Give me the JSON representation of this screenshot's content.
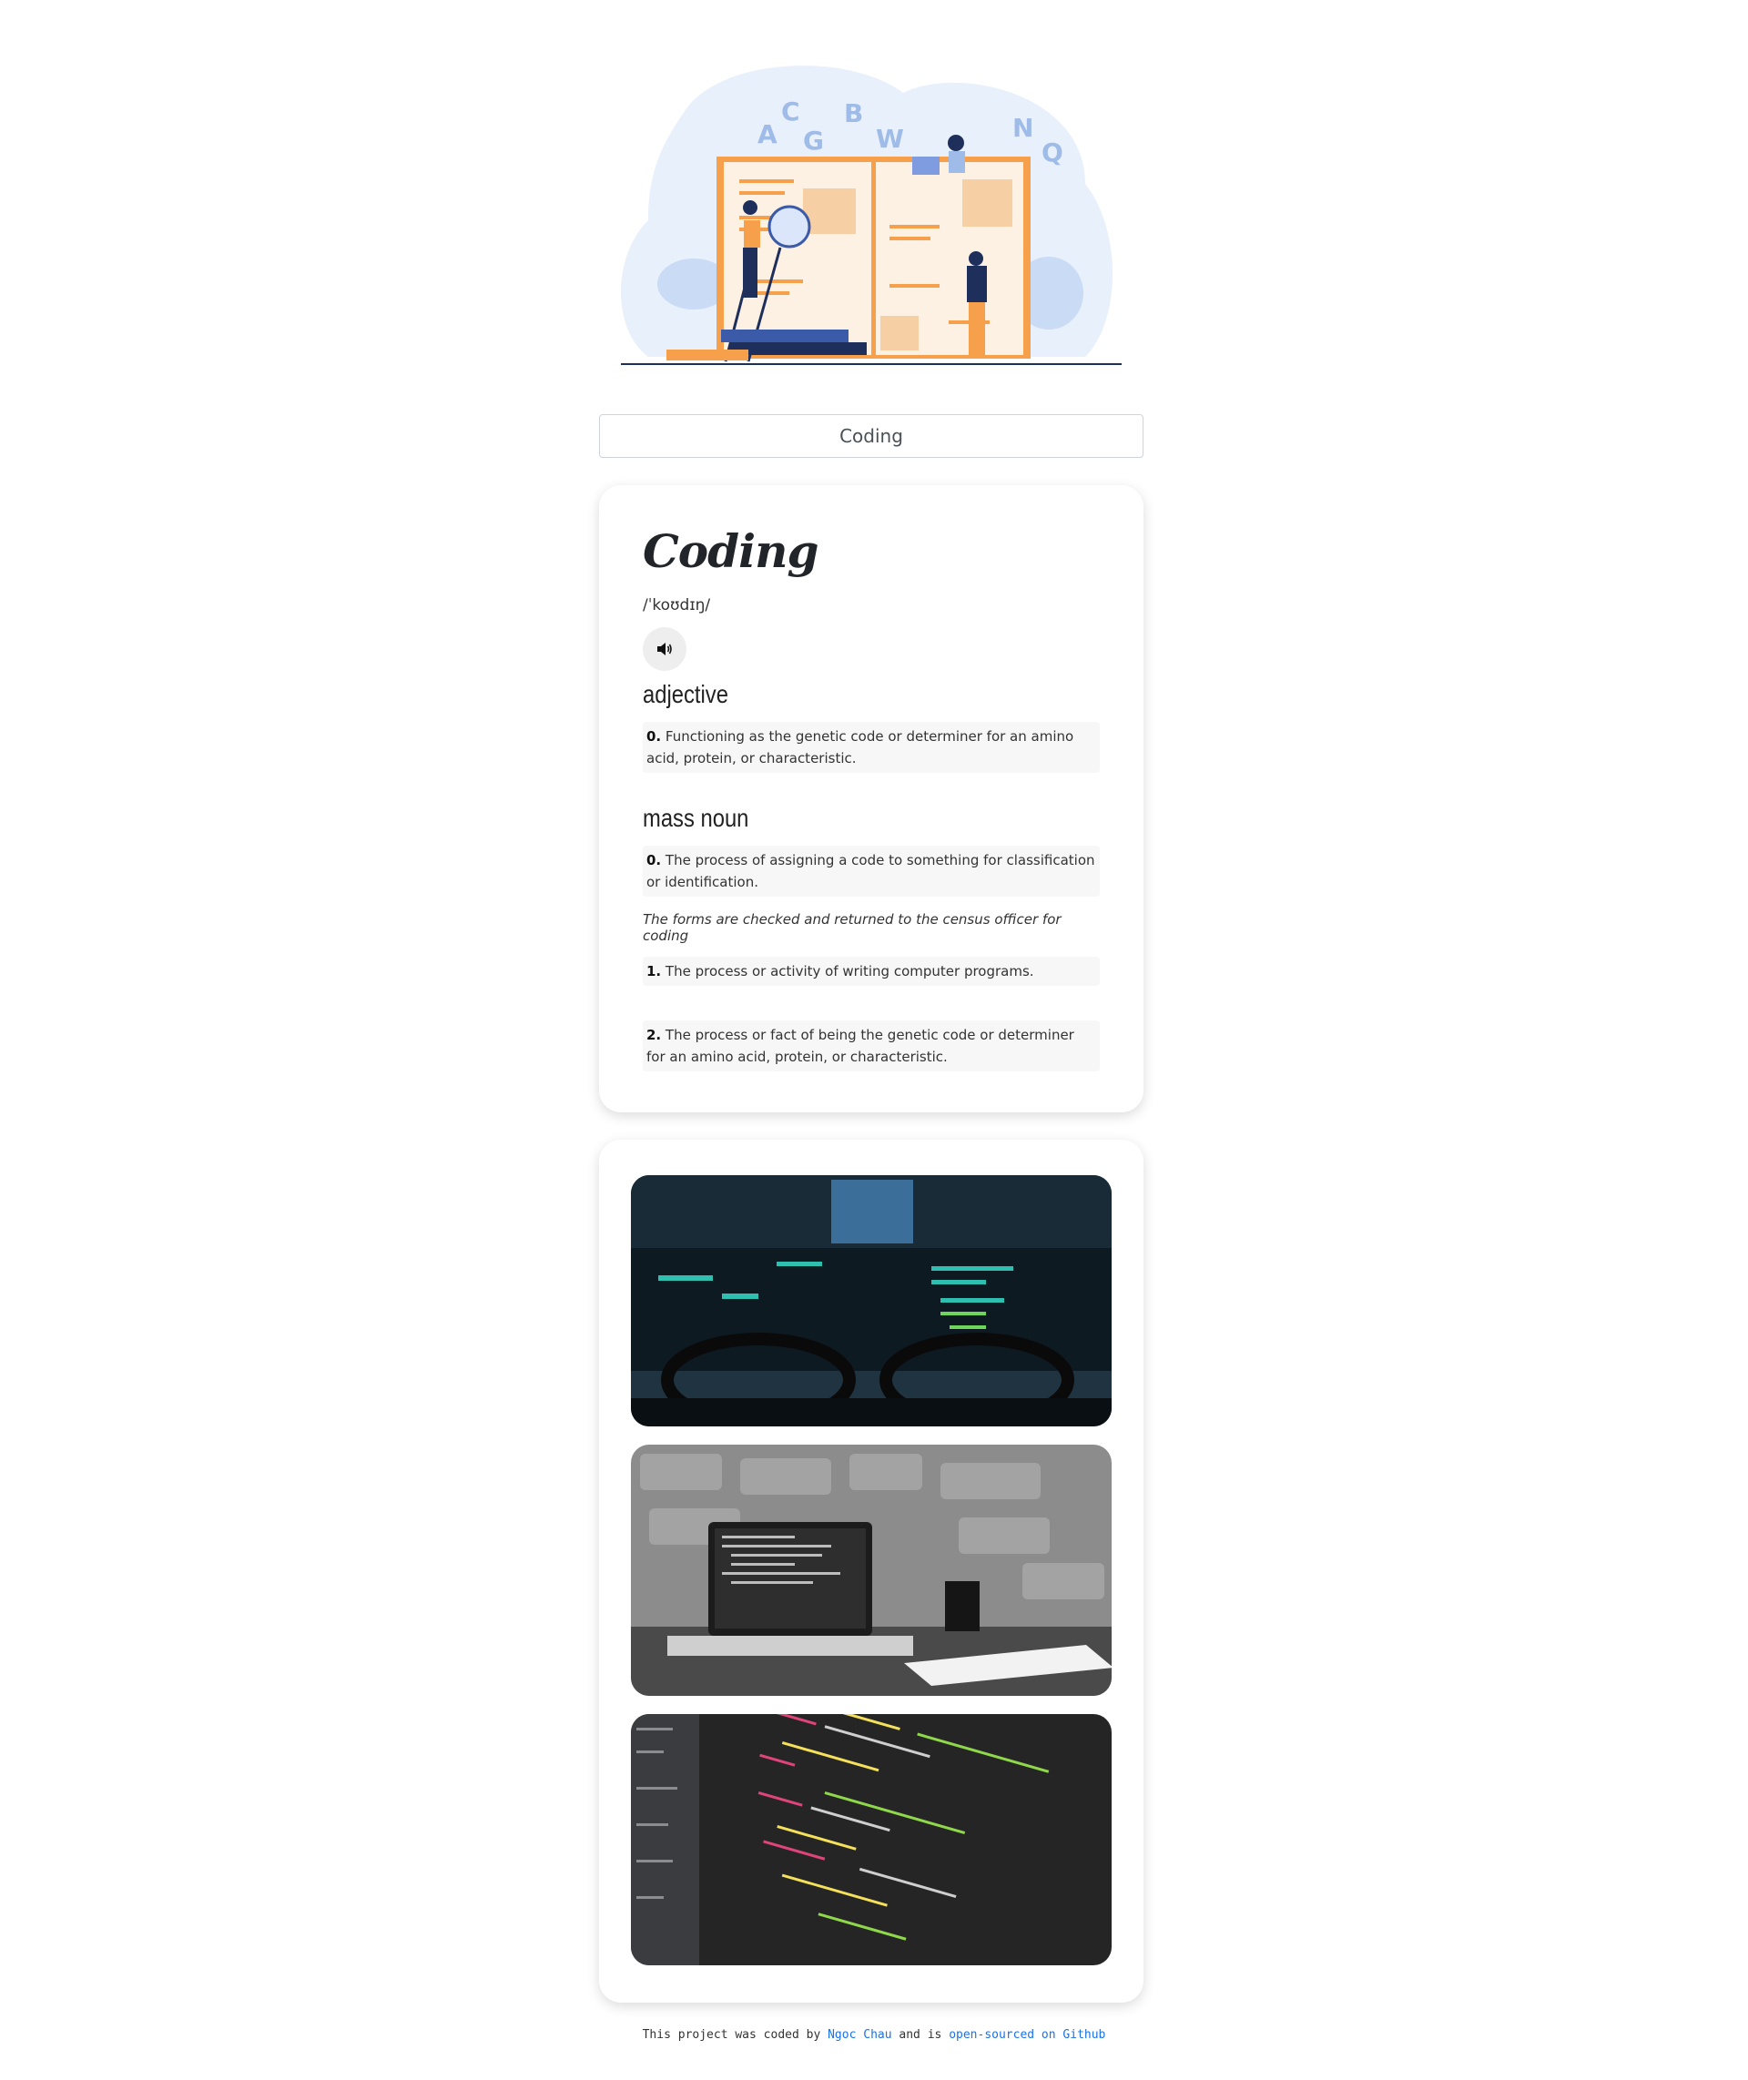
{
  "search": {
    "value": "Coding"
  },
  "entry": {
    "word": "Coding",
    "phonetic": "/ˈkoʊdɪŋ/",
    "audio_icon": "speaker-icon",
    "meanings": [
      {
        "part_of_speech": "adjective",
        "definitions": [
          {
            "index": "0.",
            "text": "Functioning as the genetic code or determiner for an amino acid, protein, or characteristic."
          }
        ]
      },
      {
        "part_of_speech": "mass noun",
        "definitions": [
          {
            "index": "0.",
            "text": "The process of assigning a code to something for classification or identification.",
            "example": "The forms are checked and returned to the census officer for coding"
          },
          {
            "index": "1.",
            "text": "The process or activity of writing computer programs."
          },
          {
            "index": "2.",
            "text": "The process or fact of being the genetic code or determiner for an amino acid, protein, or characteristic."
          }
        ]
      }
    ]
  },
  "hero": {
    "letters": [
      "A",
      "C",
      "G",
      "B",
      "W",
      "N",
      "Q"
    ]
  },
  "footer": {
    "prefix": "This project was coded by",
    "author": "Ngoc Chau",
    "middle": "and is",
    "link": "open-sourced on Github"
  }
}
